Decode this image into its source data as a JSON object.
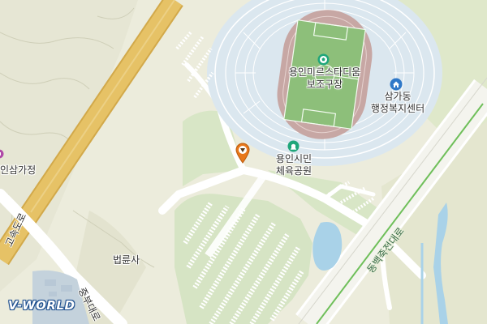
{
  "labels": {
    "stadium_sub": "용인미르스타디움\n보조구장",
    "office": "삼가동\n행정복지센터",
    "park": "용인시민\n체육공원",
    "left_place": "인삼가정",
    "temple": "법륜사",
    "road_jungbu": "중부대로",
    "road_dongbu": "동백죽전대로",
    "road_left": "고속도로"
  },
  "branding": {
    "logo_text": "V-WORLD"
  },
  "icons": {
    "stadium": "soccer-ball-icon",
    "office": "home-icon",
    "park": "park-icon",
    "pin": "location-pin-icon",
    "left_poi": "purple-poi-icon"
  },
  "colors": {
    "background": "#ececdc",
    "green_area": "#d8e6c6",
    "highway": "#e6c266",
    "highway_edge": "#d2a94a",
    "stadium_roof": "#d6e4ee",
    "pitch": "#8dbf7a",
    "track": "#c7a7a4",
    "water": "#a9d2e8",
    "rail_green": "#6fbf5a",
    "pin_orange": "#e8781a"
  }
}
